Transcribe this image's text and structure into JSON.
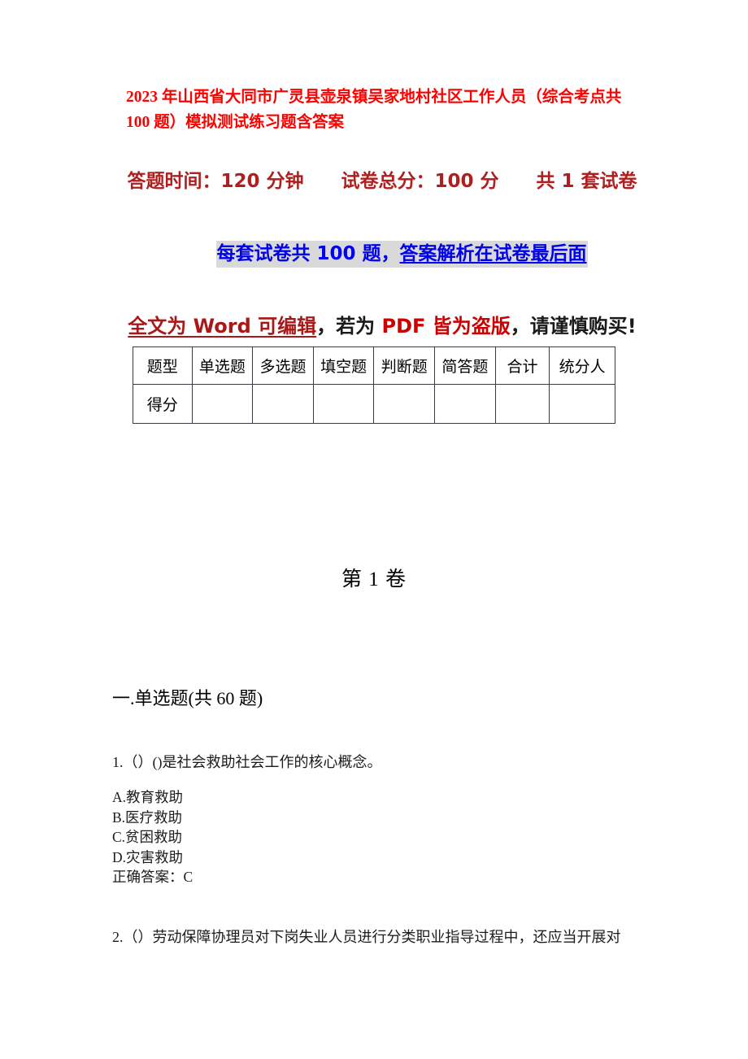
{
  "document": {
    "title": "2023 年山西省大同市广灵县壶泉镇吴家地村社区工作人员（综合考点共 100 题）模拟测试练习题含答案",
    "colors": {
      "title_red": "#ff0000",
      "subtitle_dark_red": "#b01f1f",
      "link_blue": "#0000ee",
      "highlight_gray": "#d9d9d9",
      "word_red": "#a81818",
      "pdf_red": "#cc0000",
      "table_border": "#3a3a42"
    }
  },
  "header": {
    "line1": "答题时间：120 分钟　　试卷总分：100 分　　共 1 套试卷",
    "line2_plain": "每套试卷共 100 题，",
    "line2_underlined": "答案解析在试卷最后面",
    "line3_part1": "全文为 Word 可编辑",
    "line3_part2": "，若为 ",
    "line3_part3": "PDF 皆为盗版",
    "line3_part4": "，请谨慎购买!"
  },
  "score_table": {
    "headers": [
      "题型",
      "单选题",
      "多选题",
      "填空题",
      "判断题",
      "简答题",
      "合计",
      "统分人"
    ],
    "rows": [
      [
        "得分",
        "",
        "",
        "",
        "",
        "",
        "",
        ""
      ]
    ]
  },
  "volume": {
    "label": "第 1 卷"
  },
  "section": {
    "heading": "一.单选题(共 60 题)"
  },
  "questions": [
    {
      "stem": "1.（）()是社会救助社会工作的核心概念。",
      "options": [
        "A.教育救助",
        "B.医疗救助",
        "C.贫困救助",
        "D.灾害救助"
      ],
      "answer": "正确答案：C"
    },
    {
      "stem": "2.（）劳动保障协理员对下岗失业人员进行分类职业指导过程中，还应当开展对",
      "options": [],
      "answer": ""
    }
  ]
}
